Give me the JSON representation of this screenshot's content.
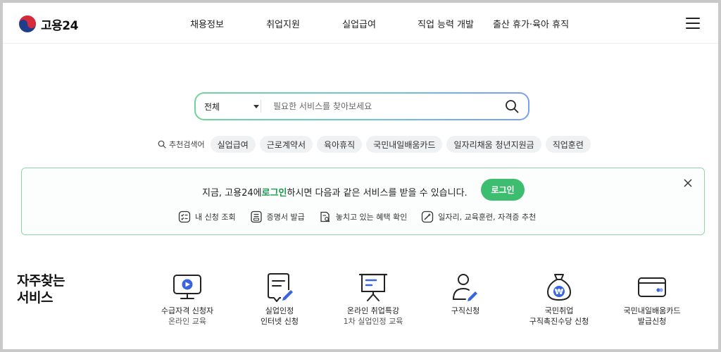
{
  "header": {
    "logo_text": "고용24",
    "nav": [
      "채용정보",
      "취업지원",
      "실업급여",
      "직업 능력 개발",
      "출산 휴가·육아 휴직"
    ]
  },
  "search": {
    "scope": "전체",
    "placeholder": "필요한 서비스를 찾아보세요"
  },
  "recommend": {
    "label": "추천검색어",
    "chips": [
      "실업급여",
      "근로계약서",
      "육아휴직",
      "국민내일배움카드",
      "일자리채움 청년지원금",
      "직업훈련"
    ]
  },
  "banner": {
    "text_before": "지금, 고용24에 ",
    "text_highlight": "로그인",
    "text_after": " 하시면 다음과 같은 서비스를 받을 수 있습니다.",
    "login_label": "로그인",
    "links": [
      "내 신청 조회",
      "증명서 발급",
      "놓치고 있는 혜택 확인",
      "일자리, 교육훈련, 자격증 추천"
    ]
  },
  "frequent": {
    "title_line1": "자주찾는",
    "title_line2": "서비스",
    "items": [
      {
        "line1": "수급자격 신청자",
        "line2": "온라인 교육",
        "icon": "monitor-play-icon"
      },
      {
        "line1": "실업인정",
        "line2": "인터넷 신청",
        "icon": "document-pen-icon"
      },
      {
        "line1": "온라인 취업특강",
        "line2": "1차 실업인정 교육",
        "icon": "presentation-board-icon"
      },
      {
        "line1": "구직신청",
        "line2": "",
        "icon": "person-pen-icon"
      },
      {
        "line1": "국민취업",
        "line2": "구직촉진수당 신청",
        "icon": "won-money-bag-icon"
      },
      {
        "line1": "국민내일배움카드",
        "line2": "발급신청",
        "icon": "card-icon"
      }
    ]
  },
  "colors": {
    "accent_green": "#3dbd6f",
    "highlight_green": "#1c9a4c",
    "icon_blue": "#3a63e0"
  }
}
